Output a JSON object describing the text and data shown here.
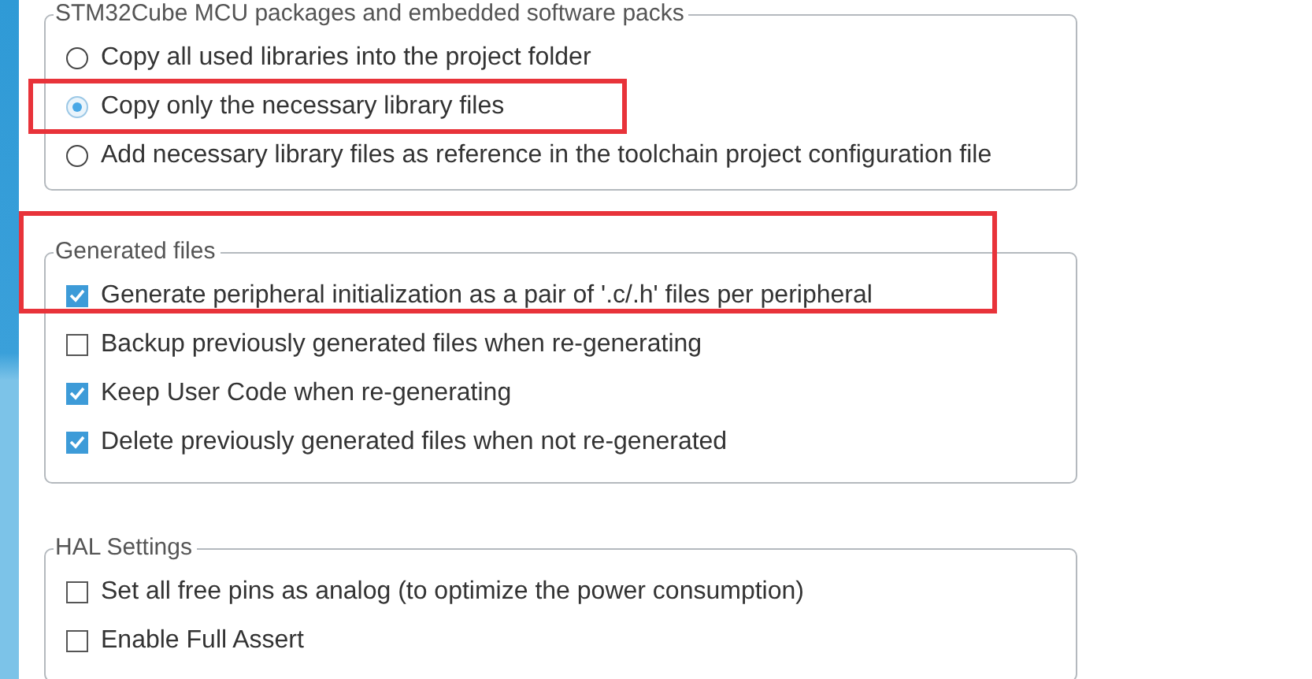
{
  "groups": [
    {
      "title": "STM32Cube MCU packages and embedded software packs",
      "items": [
        {
          "kind": "radio",
          "label": "Copy all used libraries into the project folder",
          "selected": false,
          "highlighted": false
        },
        {
          "kind": "radio",
          "label": "Copy only the necessary library files",
          "selected": true,
          "highlighted": true
        },
        {
          "kind": "radio",
          "label": "Add necessary library files as reference in the toolchain project configuration file",
          "selected": false,
          "highlighted": false
        }
      ]
    },
    {
      "title": "Generated files",
      "items": [
        {
          "kind": "checkbox",
          "label": "Generate peripheral initialization as a pair of '.c/.h' files per peripheral",
          "checked": true,
          "highlighted": true
        },
        {
          "kind": "checkbox",
          "label": "Backup previously generated files when re-generating",
          "checked": false,
          "highlighted": false
        },
        {
          "kind": "checkbox",
          "label": "Keep User Code when re-generating",
          "checked": true,
          "highlighted": false
        },
        {
          "kind": "checkbox",
          "label": "Delete previously generated files when not re-generated",
          "checked": true,
          "highlighted": false
        }
      ]
    },
    {
      "title": "HAL Settings",
      "items": [
        {
          "kind": "checkbox",
          "label": "Set all free pins as analog (to optimize the power consumption)",
          "checked": false,
          "highlighted": false
        },
        {
          "kind": "checkbox",
          "label": "Enable Full Assert",
          "checked": false,
          "highlighted": false
        }
      ]
    }
  ]
}
